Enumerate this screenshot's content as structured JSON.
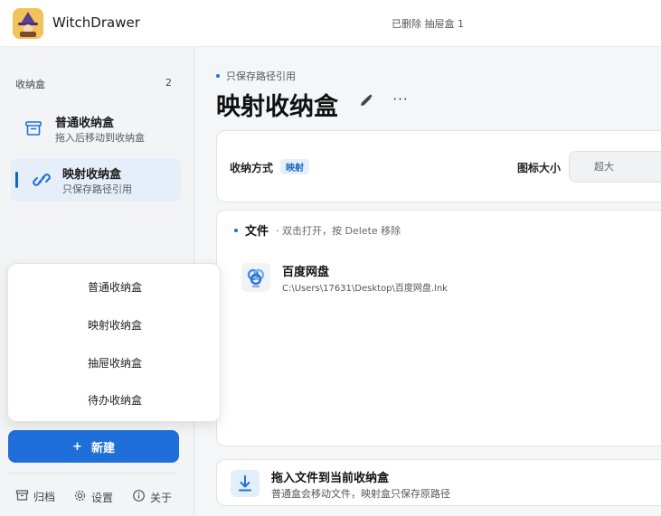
{
  "app": {
    "name": "WitchDrawer",
    "status": "已删除 抽屉盒 1"
  },
  "sidebar": {
    "header_label": "收纳盒",
    "header_count": "2",
    "items": [
      {
        "title": "普通收纳盒",
        "subtitle": "拖入后移动到收纳盒",
        "icon": "archive-box-icon",
        "active": false
      },
      {
        "title": "映射收纳盒",
        "subtitle": "只保存路径引用",
        "icon": "link-icon",
        "active": true
      }
    ],
    "new_button": {
      "icon": "+",
      "label": "新建"
    },
    "footer": [
      {
        "label": "归档",
        "icon": "archive-icon"
      },
      {
        "label": "设置",
        "icon": "gear-icon"
      },
      {
        "label": "关于",
        "icon": "info-icon"
      }
    ]
  },
  "popup_menu": {
    "items": [
      "普通收纳盒",
      "映射收纳盒",
      "抽屉收纳盒",
      "待办收纳盒"
    ]
  },
  "main": {
    "breadcrumb": "只保存路径引用",
    "title": "映射收纳盒",
    "settings": {
      "mode_label": "收纳方式",
      "mode_value": "映射",
      "icon_size_label": "图标大小",
      "icon_size_value": "超大"
    },
    "files": {
      "title": "文件",
      "hint": "· 双击打开，按 Delete 移除",
      "items": [
        {
          "name": "百度网盘",
          "path": "C:\\Users\\17631\\Desktop\\百度网盘.lnk",
          "icon": "baidu-netdisk-icon"
        }
      ]
    },
    "drop_zone": {
      "title": "拖入文件到当前收纳盒",
      "hint": "普通盒会移动文件，映射盒只保存原路径",
      "icon": "download-icon"
    }
  },
  "colors": {
    "accent": "#1e6fd9",
    "active_bg": "#e6eef9",
    "pill_bg": "#e3f0fb"
  }
}
